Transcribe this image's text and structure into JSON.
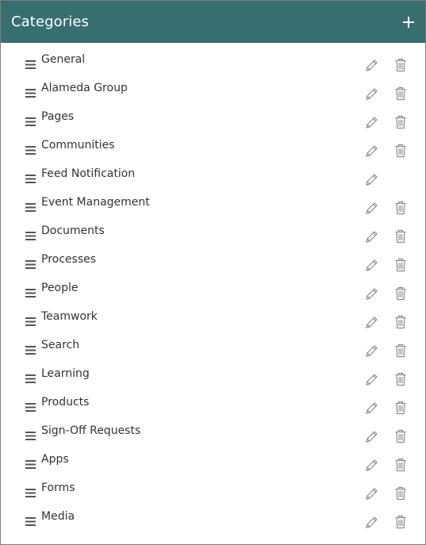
{
  "header": {
    "title": "Categories"
  },
  "colors": {
    "header_bg": "#376e70",
    "text": "#333333",
    "icon": "#8c8c8c"
  },
  "categories": [
    {
      "label": "General",
      "deletable": true
    },
    {
      "label": "Alameda Group",
      "deletable": true
    },
    {
      "label": "Pages",
      "deletable": true
    },
    {
      "label": "Communities",
      "deletable": true
    },
    {
      "label": "Feed Notification",
      "deletable": false
    },
    {
      "label": "Event Management",
      "deletable": true
    },
    {
      "label": "Documents",
      "deletable": true
    },
    {
      "label": "Processes",
      "deletable": true
    },
    {
      "label": "People",
      "deletable": true
    },
    {
      "label": "Teamwork",
      "deletable": true
    },
    {
      "label": "Search",
      "deletable": true
    },
    {
      "label": "Learning",
      "deletable": true
    },
    {
      "label": "Products",
      "deletable": true
    },
    {
      "label": "Sign-Off Requests",
      "deletable": true
    },
    {
      "label": "Apps",
      "deletable": true
    },
    {
      "label": "Forms",
      "deletable": true
    },
    {
      "label": "Media",
      "deletable": true
    }
  ]
}
